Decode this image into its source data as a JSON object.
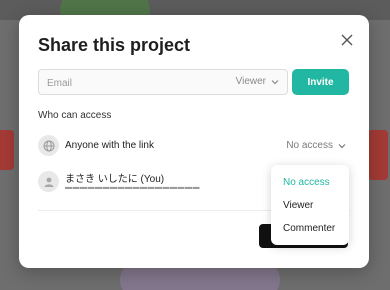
{
  "modal": {
    "title": "Share this project"
  },
  "invite_form": {
    "email_placeholder": "Email",
    "email_value": "",
    "role": "Viewer",
    "invite_label": "Invite"
  },
  "access": {
    "section_label": "Who can access",
    "link_row": {
      "label": "Anyone with the link",
      "value": "No access"
    },
    "user_row": {
      "name": "まさき いしたに (You)",
      "email_masked": "▬▬▬▬▬▬▬▬▬▬▬▬▬▬▬▬▬▬"
    }
  },
  "dropdown": {
    "options": [
      "No access",
      "Viewer",
      "Commenter"
    ],
    "selected": "No access"
  },
  "colors": {
    "accent": "#22b7a2",
    "primary_button": "#111111",
    "backdrop": "#6e6e6e"
  },
  "icons": {
    "close": "close-icon",
    "globe": "globe-icon",
    "user": "user-icon",
    "chevron": "chevron-down-icon"
  }
}
